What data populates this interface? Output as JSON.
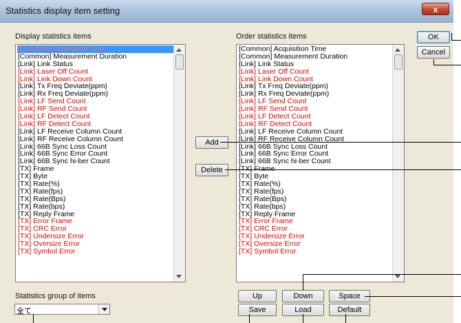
{
  "window": {
    "title": "Statistics display item setting",
    "close_glyph": "x"
  },
  "display_list": {
    "label": "Display statistics items",
    "items": [
      {
        "text": "[Common] Acquisition Time",
        "red": false,
        "selected": true
      },
      {
        "text": "[Common] Measurement Duration",
        "red": false
      },
      {
        "text": "[Link] Link Status",
        "red": false
      },
      {
        "text": "[Link] Laser Off Count",
        "red": true
      },
      {
        "text": "[Link] Link Down Count",
        "red": true
      },
      {
        "text": "[Link] Tx Freq Deviate(ppm)",
        "red": false
      },
      {
        "text": "[Link] Rx Freq Deviate(ppm)",
        "red": false
      },
      {
        "text": "[Link] LF Send Count",
        "red": true
      },
      {
        "text": "[Link] RF Send Count",
        "red": true
      },
      {
        "text": "[Link] LF Detect Count",
        "red": true
      },
      {
        "text": "[Link] RF Detect Count",
        "red": true
      },
      {
        "text": "[Link] LF Receive Column Count",
        "red": false
      },
      {
        "text": "[Link] RF Receive Column Count",
        "red": false
      },
      {
        "text": "[Link] 66B Sync Loss Count",
        "red": false
      },
      {
        "text": "[Link] 66B Sync Error Count",
        "red": false
      },
      {
        "text": "[Link] 66B Sync hi-ber Count",
        "red": false
      },
      {
        "text": "[TX] Frame",
        "red": false
      },
      {
        "text": "[TX] Byte",
        "red": false
      },
      {
        "text": "[TX] Rate(%)",
        "red": false
      },
      {
        "text": "[TX] Rate(fps)",
        "red": false
      },
      {
        "text": "[TX] Rate(Bps)",
        "red": false
      },
      {
        "text": "[TX] Rate(bps)",
        "red": false
      },
      {
        "text": "[TX] Reply Frame",
        "red": false
      },
      {
        "text": "[TX] Error Frame",
        "red": true
      },
      {
        "text": "[TX] CRC Error",
        "red": true
      },
      {
        "text": "[TX] Undersize Error",
        "red": true
      },
      {
        "text": "[TX] Oversize Error",
        "red": true
      },
      {
        "text": "[TX] Symbol Error",
        "red": true
      }
    ]
  },
  "order_list": {
    "label": "Order statistics items",
    "items": [
      {
        "text": "[Common] Acquisition Time",
        "red": false
      },
      {
        "text": "[Common] Measurement Duration",
        "red": false
      },
      {
        "text": "[Link] Link Status",
        "red": false
      },
      {
        "text": "[Link] Laser Off Count",
        "red": true
      },
      {
        "text": "[Link] Link Down Count",
        "red": true
      },
      {
        "text": "[Link] Tx Freq Deviate(ppm)",
        "red": false
      },
      {
        "text": "[Link] Rx Freq Deviate(ppm)",
        "red": false
      },
      {
        "text": "[Link] LF Send Count",
        "red": true
      },
      {
        "text": "[Link] RF Send Count",
        "red": true
      },
      {
        "text": "[Link] LF Detect Count",
        "red": true
      },
      {
        "text": "[Link] RF Detect Count",
        "red": true
      },
      {
        "text": "[Link] LF Receive Column Count",
        "red": false
      },
      {
        "text": "[Link] RF Receive Column Count",
        "red": false
      },
      {
        "text": "[Link] 66B Sync Loss Count",
        "red": false
      },
      {
        "text": "[Link] 66B Sync Error Count",
        "red": false
      },
      {
        "text": "[Link] 66B Sync hi-ber Count",
        "red": false
      },
      {
        "text": "[TX] Frame",
        "red": false
      },
      {
        "text": "[TX] Byte",
        "red": false
      },
      {
        "text": "[TX] Rate(%)",
        "red": false
      },
      {
        "text": "[TX] Rate(fps)",
        "red": false
      },
      {
        "text": "[TX] Rate(Bps)",
        "red": false
      },
      {
        "text": "[TX] Rate(bps)",
        "red": false
      },
      {
        "text": "[TX] Reply Frame",
        "red": false
      },
      {
        "text": "[TX] Error Frame",
        "red": true
      },
      {
        "text": "[TX] CRC Error",
        "red": true
      },
      {
        "text": "[TX] Undersize Error",
        "red": true
      },
      {
        "text": "[TX] Oversize Error",
        "red": true
      },
      {
        "text": "[TX] Symbol Error",
        "red": true
      }
    ]
  },
  "buttons": {
    "ok": "OK",
    "cancel": "Cancel",
    "add": "Add",
    "delete": "Delete",
    "up": "Up",
    "down": "Down",
    "space": "Space",
    "save": "Save",
    "load": "Load",
    "default": "Default"
  },
  "group": {
    "label": "Statistics group of items",
    "value": "全て"
  },
  "colors": {
    "red_item": "#e00000",
    "selection": "#3399ff"
  }
}
